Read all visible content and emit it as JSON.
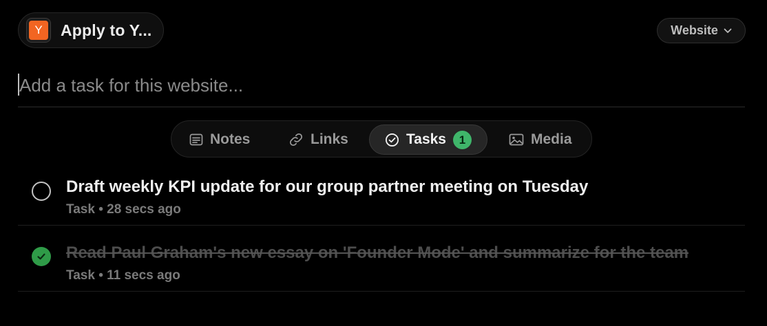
{
  "header": {
    "favicon_letter": "Y",
    "site_title": "Apply to Y...",
    "scope_label": "Website"
  },
  "input": {
    "placeholder": "Add a task for this website...",
    "value": ""
  },
  "tabs": [
    {
      "label": "Notes",
      "icon": "notes-icon",
      "active": false
    },
    {
      "label": "Links",
      "icon": "link-icon",
      "active": false
    },
    {
      "label": "Tasks",
      "icon": "check-circle-icon",
      "active": true,
      "count": "1"
    },
    {
      "label": "Media",
      "icon": "image-icon",
      "active": false
    }
  ],
  "tasks": [
    {
      "title": "Draft weekly KPI update for our group partner meeting on Tuesday",
      "type": "Task",
      "separator": "•",
      "time": "28 secs ago",
      "completed": false
    },
    {
      "title": "Read Paul Graham's new essay on 'Founder Mode' and summarize for the team",
      "type": "Task",
      "separator": "•",
      "time": "11 secs ago",
      "completed": true
    }
  ],
  "colors": {
    "background": "#000000",
    "accent_badge": "#3fb56a",
    "check_done": "#2f9b48",
    "favicon": "#f26522"
  }
}
